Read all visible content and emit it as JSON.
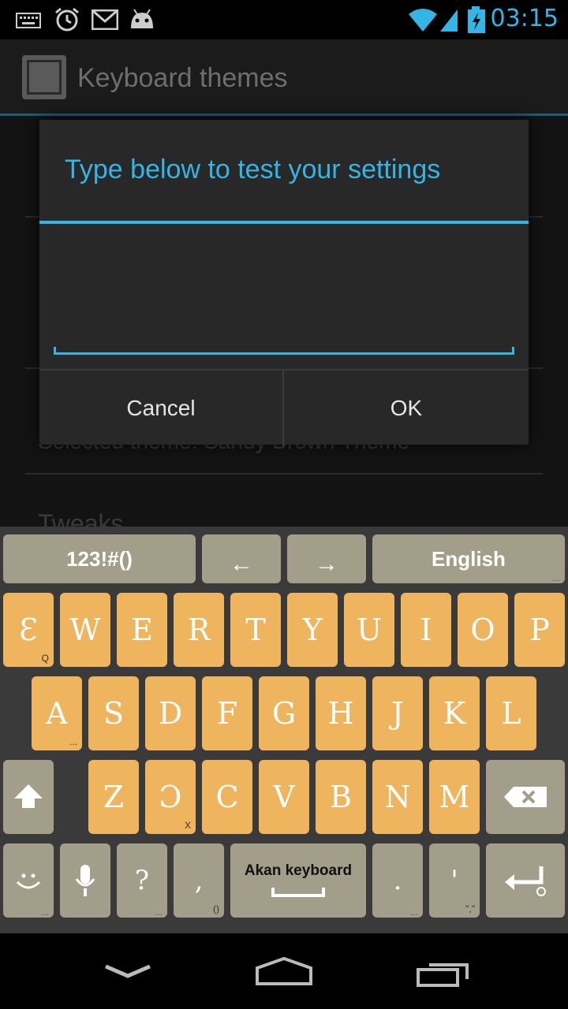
{
  "status_bar": {
    "time": "03:15"
  },
  "app": {
    "title": "Keyboard themes",
    "selected_theme_text": "Selected theme: Sandy Brown Theme",
    "tweaks_header": "Tweaks"
  },
  "dialog": {
    "title": "Type below to test your settings",
    "input_value": "",
    "cancel_label": "Cancel",
    "ok_label": "OK"
  },
  "keyboard": {
    "row0": {
      "symbols": "123!#()",
      "left_arrow": "←",
      "right_arrow": "→",
      "language": "English"
    },
    "row1": [
      {
        "label": "Ɛ",
        "sub": "Q"
      },
      {
        "label": "W",
        "sub": ""
      },
      {
        "label": "E",
        "sub": ""
      },
      {
        "label": "R",
        "sub": ""
      },
      {
        "label": "T",
        "sub": ""
      },
      {
        "label": "Y",
        "sub": ""
      },
      {
        "label": "U",
        "sub": ""
      },
      {
        "label": "I",
        "sub": ""
      },
      {
        "label": "O",
        "sub": ""
      },
      {
        "label": "P",
        "sub": ""
      }
    ],
    "row2": [
      {
        "label": "A",
        "sub": "..."
      },
      {
        "label": "S",
        "sub": ""
      },
      {
        "label": "D",
        "sub": ""
      },
      {
        "label": "F",
        "sub": ""
      },
      {
        "label": "G",
        "sub": ""
      },
      {
        "label": "H",
        "sub": ""
      },
      {
        "label": "J",
        "sub": ""
      },
      {
        "label": "K",
        "sub": ""
      },
      {
        "label": "L",
        "sub": ""
      }
    ],
    "row3": [
      {
        "label": "Z",
        "sub": ""
      },
      {
        "label": "Ɔ",
        "sub": "X"
      },
      {
        "label": "C",
        "sub": ""
      },
      {
        "label": "V",
        "sub": ""
      },
      {
        "label": "B",
        "sub": ""
      },
      {
        "label": "N",
        "sub": ""
      },
      {
        "label": "M",
        "sub": ""
      }
    ],
    "row4": {
      "question": "?",
      "comma": ",",
      "comma_sub": "()",
      "space_label": "Akan keyboard",
      "period": ".",
      "apostrophe": "'",
      "apostrophe_sub": "\",\"",
      "more": "..."
    },
    "colors": {
      "letter_key": "#efb45e",
      "function_key": "#a39e8a",
      "background": "#3a3a3a"
    }
  },
  "colors": {
    "accent": "#33b5e5"
  }
}
